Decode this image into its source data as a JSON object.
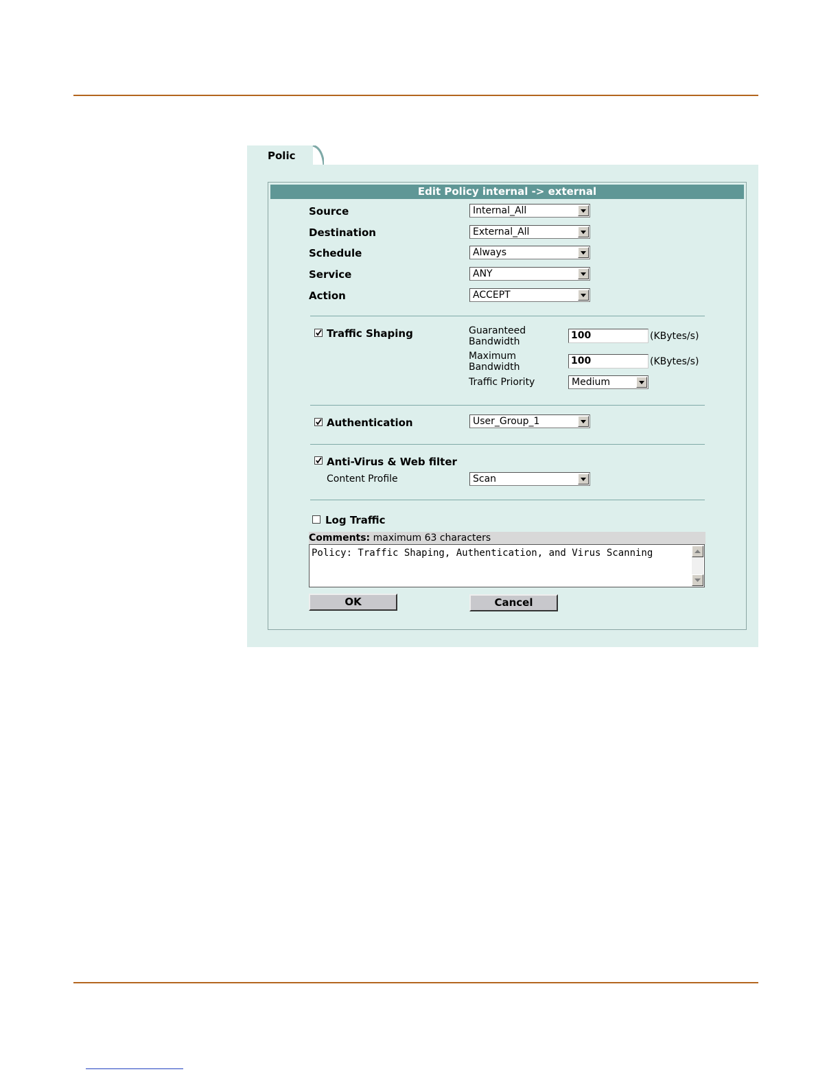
{
  "tab": {
    "label": "Policy"
  },
  "dialog": {
    "title": "Edit Policy internal -> external"
  },
  "fields": {
    "source": {
      "label": "Source",
      "value": "Internal_All"
    },
    "destination": {
      "label": "Destination",
      "value": "External_All"
    },
    "schedule": {
      "label": "Schedule",
      "value": "Always"
    },
    "service": {
      "label": "Service",
      "value": "ANY"
    },
    "action": {
      "label": "Action",
      "value": "ACCEPT"
    }
  },
  "traffic_shaping": {
    "label": "Traffic Shaping",
    "checked": true,
    "guaranteed_label": "Guaranteed Bandwidth",
    "guaranteed_value": "100",
    "maximum_label": "Maximum Bandwidth",
    "maximum_value": "100",
    "unit": "(KBytes/s)",
    "priority_label": "Traffic Priority",
    "priority_value": "Medium"
  },
  "authentication": {
    "label": "Authentication",
    "checked": true,
    "value": "User_Group_1"
  },
  "antivirus": {
    "label": "Anti-Virus & Web filter",
    "checked": true,
    "profile_label": "Content Profile",
    "profile_value": "Scan"
  },
  "log_traffic": {
    "label": "Log Traffic",
    "checked": false
  },
  "comments": {
    "label": "Comments:",
    "hint": "maximum 63 characters",
    "value": "Policy: Traffic Shaping, Authentication, and Virus Scanning"
  },
  "buttons": {
    "ok": "OK",
    "cancel": "Cancel"
  },
  "colors": {
    "rule": "#b3651e",
    "panel": "#ddefec",
    "title_bar": "#5f9796"
  }
}
